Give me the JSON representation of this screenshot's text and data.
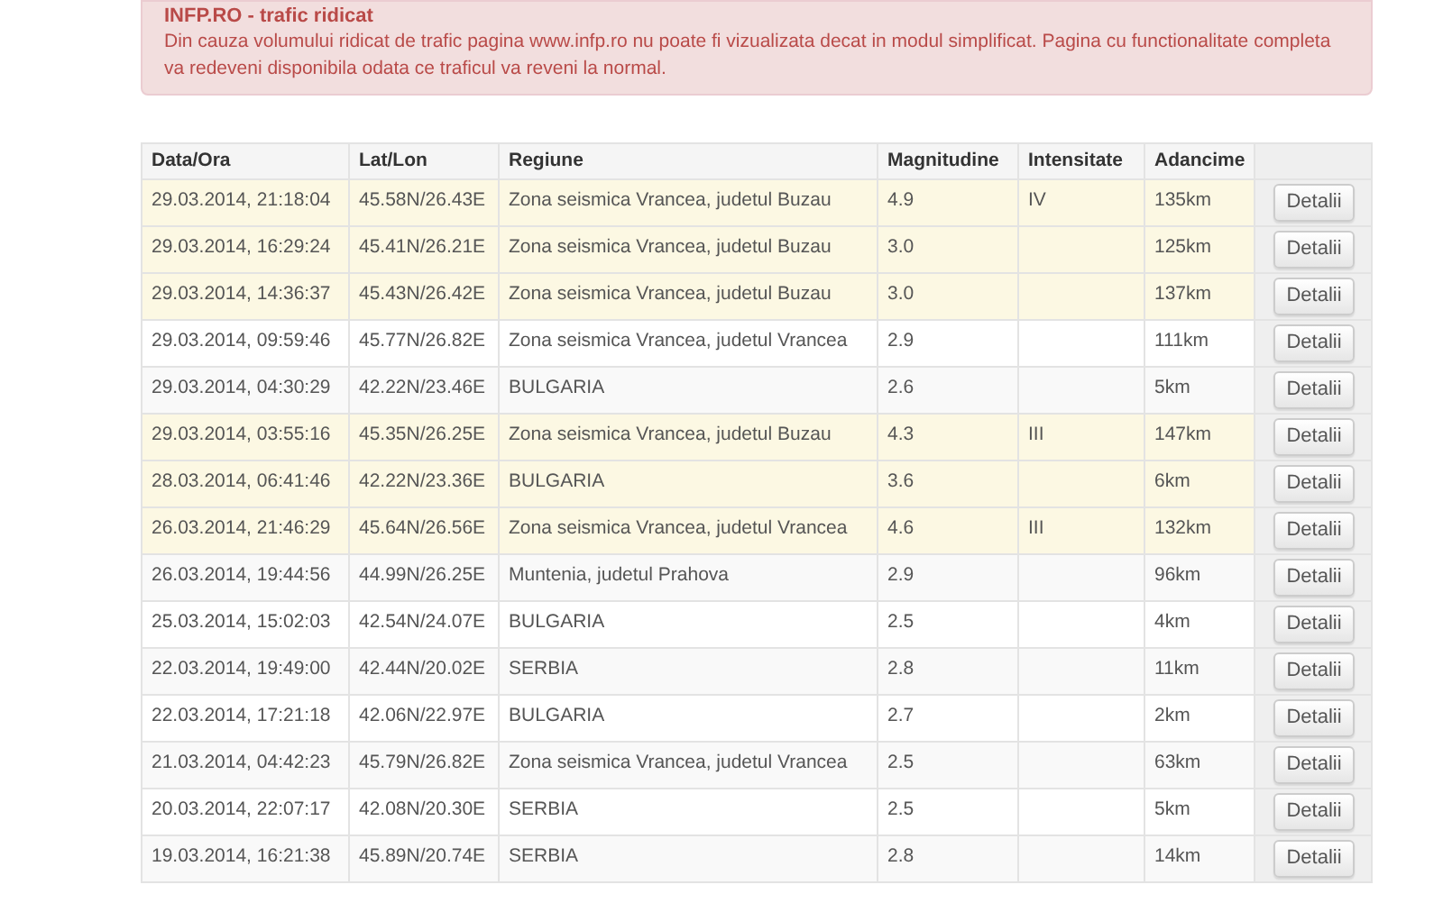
{
  "alert": {
    "title": "INFP.RO - trafic ridicat",
    "message": "Din cauza volumului ridicat de trafic pagina www.infp.ro nu poate fi vizualizata decat in modul simplificat. Pagina cu functionalitate completa va redeveni disponibila odata ce traficul va reveni la normal."
  },
  "table": {
    "columns": [
      "Data/Ora",
      "Lat/Lon",
      "Regiune",
      "Magnitudine",
      "Intensitate",
      "Adancime"
    ],
    "rows": [
      {
        "date": "29.03.2014, 21:18:04",
        "latlon": "45.58N/26.43E",
        "region": "Zona seismica Vrancea, judetul Buzau",
        "magnitude": "4.9",
        "intensity": "IV",
        "depth": "135km",
        "highlighted": true,
        "button": "Detalii"
      },
      {
        "date": "29.03.2014, 16:29:24",
        "latlon": "45.41N/26.21E",
        "region": "Zona seismica Vrancea, judetul Buzau",
        "magnitude": "3.0",
        "depth": "125km",
        "highlighted": true,
        "button": "Detalii"
      },
      {
        "date": "29.03.2014, 14:36:37",
        "latlon": "45.43N/26.42E",
        "region": "Zona seismica Vrancea, judetul Buzau",
        "magnitude": "3.0",
        "depth": "137km",
        "highlighted": true,
        "button": "Detalii"
      },
      {
        "date": "29.03.2014, 09:59:46",
        "latlon": "45.77N/26.82E",
        "region": "Zona seismica Vrancea, judetul Vrancea",
        "magnitude": "2.9",
        "depth": "111km",
        "highlighted": false,
        "button": "Detalii"
      },
      {
        "date": "29.03.2014, 04:30:29",
        "latlon": "42.22N/23.46E",
        "region": "BULGARIA",
        "magnitude": "2.6",
        "depth": "5km",
        "highlighted": false,
        "button": "Detalii"
      },
      {
        "date": "29.03.2014, 03:55:16",
        "latlon": "45.35N/26.25E",
        "region": "Zona seismica Vrancea, judetul Buzau",
        "magnitude": "4.3",
        "intensity": "III",
        "depth": "147km",
        "highlighted": true,
        "button": "Detalii"
      },
      {
        "date": "28.03.2014, 06:41:46",
        "latlon": "42.22N/23.36E",
        "region": "BULGARIA",
        "magnitude": "3.6",
        "depth": "6km",
        "highlighted": true,
        "button": "Detalii"
      },
      {
        "date": "26.03.2014, 21:46:29",
        "latlon": "45.64N/26.56E",
        "region": "Zona seismica Vrancea, judetul Vrancea",
        "magnitude": "4.6",
        "intensity": "III",
        "depth": "132km",
        "highlighted": true,
        "button": "Detalii"
      },
      {
        "date": "26.03.2014, 19:44:56",
        "latlon": "44.99N/26.25E",
        "region": "Muntenia, judetul Prahova",
        "magnitude": "2.9",
        "depth": "96km",
        "highlighted": false,
        "button": "Detalii"
      },
      {
        "date": "25.03.2014, 15:02:03",
        "latlon": "42.54N/24.07E",
        "region": "BULGARIA",
        "magnitude": "2.5",
        "depth": "4km",
        "highlighted": false,
        "button": "Detalii"
      },
      {
        "date": "22.03.2014, 19:49:00",
        "latlon": "42.44N/20.02E",
        "region": "SERBIA",
        "magnitude": "2.8",
        "depth": "11km",
        "highlighted": false,
        "button": "Detalii"
      },
      {
        "date": "22.03.2014, 17:21:18",
        "latlon": "42.06N/22.97E",
        "region": "BULGARIA",
        "magnitude": "2.7",
        "depth": "2km",
        "highlighted": false,
        "button": "Detalii"
      },
      {
        "date": "21.03.2014, 04:42:23",
        "latlon": "45.79N/26.82E",
        "region": "Zona seismica Vrancea, judetul Vrancea",
        "magnitude": "2.5",
        "depth": "63km",
        "highlighted": false,
        "button": "Detalii"
      },
      {
        "date": "20.03.2014, 22:07:17",
        "latlon": "42.08N/20.30E",
        "region": "SERBIA",
        "magnitude": "2.5",
        "depth": "5km",
        "highlighted": false,
        "button": "Detalii"
      },
      {
        "date": "19.03.2014, 16:21:38",
        "latlon": "45.89N/20.74E",
        "region": "SERBIA",
        "magnitude": "2.8",
        "depth": "14km",
        "highlighted": false,
        "button": "Detalii"
      }
    ]
  }
}
